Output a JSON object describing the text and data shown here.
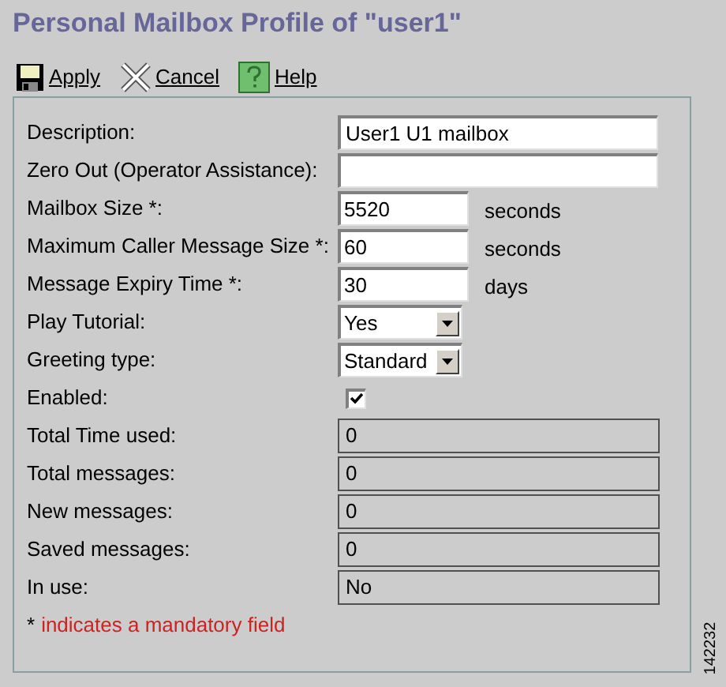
{
  "title": "Personal Mailbox Profile of \"user1\"",
  "toolbar": [
    {
      "kind": "save",
      "label": "Apply"
    },
    {
      "kind": "cancel",
      "label": "Cancel"
    },
    {
      "kind": "help",
      "label": "Help"
    }
  ],
  "fields": [
    {
      "kind": "text",
      "label": "Description:",
      "value": "User1 U1 mailbox"
    },
    {
      "kind": "text",
      "label": "Zero Out (Operator Assistance):"
    },
    {
      "kind": "number",
      "label": "Mailbox Size *:",
      "value": "5520",
      "unit": "seconds"
    },
    {
      "kind": "number",
      "label": "Maximum Caller Message Size *:",
      "value": "60",
      "unit": "seconds"
    },
    {
      "kind": "number",
      "label": "Message Expiry Time *:",
      "value": "30",
      "unit": "days"
    },
    {
      "kind": "select",
      "label": "Play Tutorial:",
      "value": "Yes"
    },
    {
      "kind": "select",
      "label": "Greeting type:",
      "value": "Standard"
    },
    {
      "kind": "checkbox",
      "label": "Enabled:",
      "checked": true
    },
    {
      "kind": "readonly",
      "label": "Total Time used:",
      "value": "0"
    },
    {
      "kind": "readonly",
      "label": "Total messages:",
      "value": "0"
    },
    {
      "kind": "readonly",
      "label": "New messages:",
      "value": "0"
    },
    {
      "kind": "readonly",
      "label": "Saved messages:",
      "value": "0"
    },
    {
      "kind": "readonly",
      "label": "In use:",
      "value": "No"
    }
  ],
  "footnote": {
    "mark": "*",
    "text": "indicates a mandatory field"
  },
  "figure_number": "142232"
}
